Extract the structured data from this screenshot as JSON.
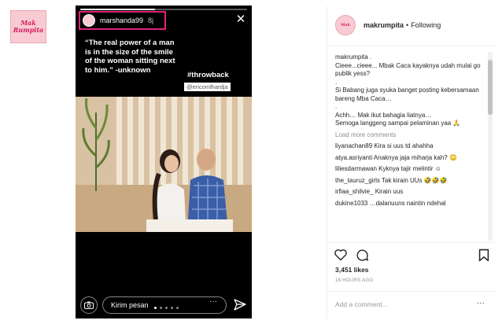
{
  "thumbnail": {
    "line1": "Mak",
    "line2": "Rumpita"
  },
  "story": {
    "username": "marshanda99",
    "time": "8j",
    "quote": "“The real power of a man is in the size of the smile of the woman sitting next to him.” -unknown",
    "hashtag": "#throwback",
    "mention": "@ericomlhardja",
    "message_placeholder": "Kirim pesan",
    "more_label": "···",
    "progress_fraction": 0.45
  },
  "post": {
    "username": "makrumpita",
    "separator": "•",
    "follow_status": "Following",
    "caption": {
      "user": "makrumpita .",
      "lines": [
        "Cieee...cieee... Mbak Caca kayaknya udah mulai go publik yess?",
        ".",
        "Si Babang juga syuka banget posting kebersamaan bareng Mba Caca…",
        ".",
        "Achh… Mak ikut bahagia liatnya…",
        "Semoga langgeng sampai pelaminan yaa 🙏"
      ]
    },
    "load_more": "Load more comments",
    "comments": [
      {
        "user": "liyanachan89",
        "text": "Kira si uus td ahahha"
      },
      {
        "user": "atya.asriyanti",
        "text": "Anaknya jaja miharja kah? 😳"
      },
      {
        "user": "liliesdarmawan",
        "text": "Kyknya tajir melintir ☺"
      },
      {
        "user": "the_tauruz_girls",
        "text": "Tak kirain UUs 🤣🤣🤣"
      },
      {
        "user": "irfiaa_shilvie_",
        "text": "Kirain uus"
      },
      {
        "user": "dukine1033",
        "text": "…dalanuuns naintin ndehal"
      }
    ],
    "likes": "3,451 likes",
    "timestamp": "18 HOURS AGO",
    "add_comment_placeholder": "Add a comment…",
    "add_more": "···"
  },
  "icons": {
    "close": "close-icon",
    "camera": "camera-icon",
    "send": "send-icon",
    "heart": "heart-icon",
    "comment": "comment-icon",
    "bookmark": "bookmark-icon"
  },
  "colors": {
    "highlight_border": "#e0217a",
    "story_bg": "#000000",
    "muted": "#8e8e8e"
  }
}
